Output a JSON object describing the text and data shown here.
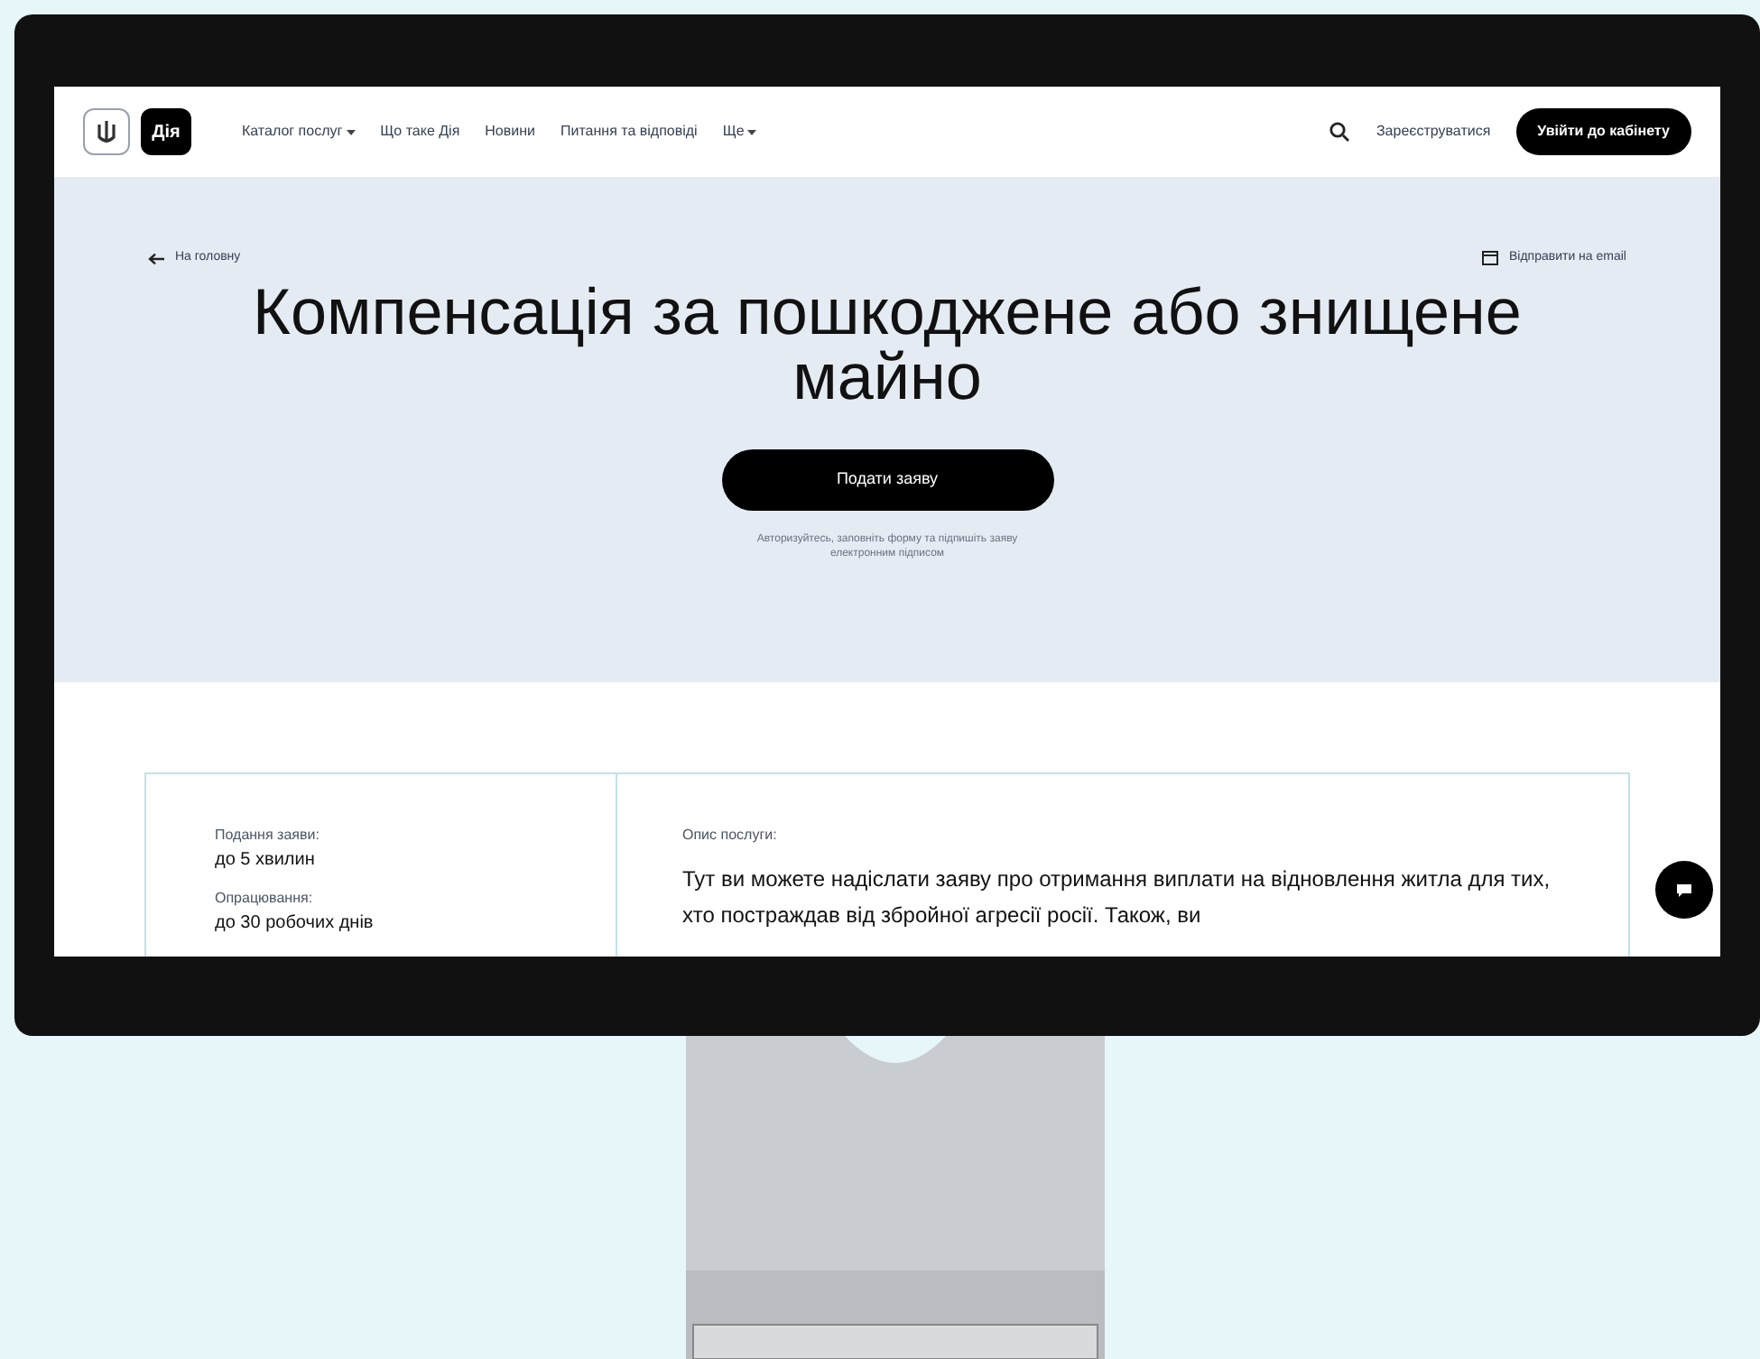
{
  "header": {
    "logo_text": "Дія",
    "nav": [
      {
        "label": "Каталог послуг",
        "dropdown": true
      },
      {
        "label": "Що таке Дія",
        "dropdown": false
      },
      {
        "label": "Новини",
        "dropdown": false
      },
      {
        "label": "Питання та відповіді",
        "dropdown": false
      },
      {
        "label": "Ще",
        "dropdown": true
      }
    ],
    "register": "Зареєструватися",
    "login": "Увійти до кабінету"
  },
  "hero": {
    "back": "На головну",
    "email": "Відправити на email",
    "title": "Компенсація за пошкоджене або знищене майно",
    "apply": "Подати заяву",
    "hint": "Авторизуйтесь, заповніть форму та підпишіть заяву електронним підписом"
  },
  "info": {
    "facts": [
      {
        "label": "Подання заяви:",
        "value": "до 5 хвилин"
      },
      {
        "label": "Опрацювання:",
        "value": "до 30 робочих днів"
      }
    ],
    "description_label": "Опис послуги:",
    "description": "Тут ви можете надіслати заяву про отримання виплати на відновлення житла для тих, хто постраждав від збройної агресії росії. Також, ви"
  }
}
